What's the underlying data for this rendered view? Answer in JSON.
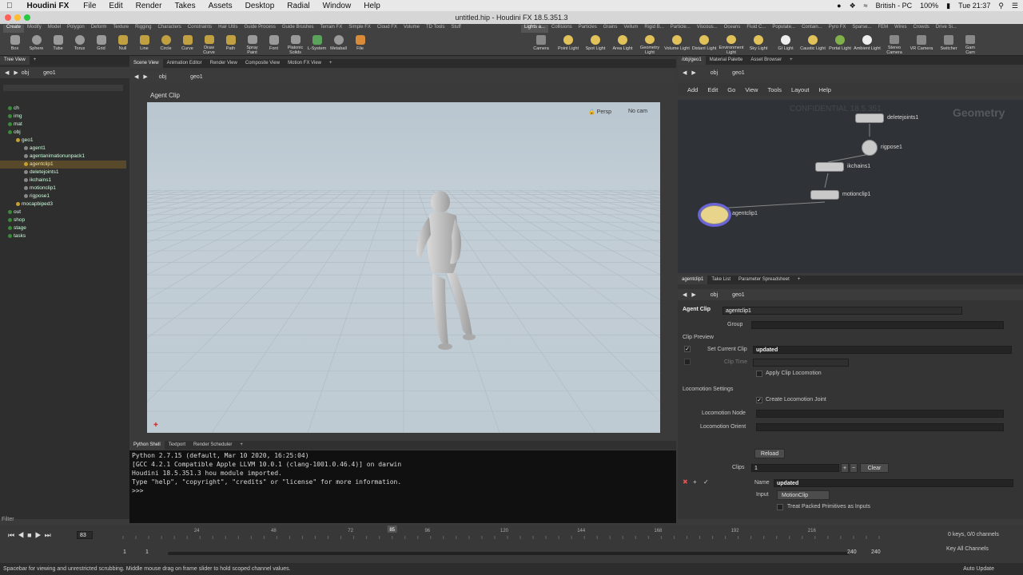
{
  "menubar": {
    "app": "Houdini FX",
    "items": [
      "File",
      "Edit",
      "Render",
      "Takes",
      "Assets",
      "Desktop",
      "Radial",
      "Window",
      "Help"
    ],
    "input_source": "British - PC",
    "battery": "100%",
    "clock": "Tue 21:37"
  },
  "window_title": "untitled.hip - Houdini FX 18.5.351.3",
  "shelf": {
    "tabs_left": [
      "Create",
      "Modify",
      "Model",
      "Polygon",
      "Deform",
      "Texture",
      "Rigging",
      "Characters",
      "Constraints",
      "Hair Utils",
      "Guide Process",
      "Guide Brushes",
      "Terrain FX",
      "Simple FX",
      "Cloud FX",
      "Volume",
      "TD Tools",
      "Stuff"
    ],
    "tools_left": [
      "Box",
      "Sphere",
      "Tube",
      "Torus",
      "Grid",
      "Null",
      "Line",
      "Circle",
      "Curve",
      "Draw Curve",
      "Path",
      "Spray Paint",
      "Font",
      "Platonic Solids",
      "L-System",
      "Metaball",
      "File"
    ],
    "tabs_right": [
      "Lights a...",
      "Collisions",
      "Particles",
      "Grains",
      "Vellum",
      "Rigid B...",
      "Particle...",
      "Viscous...",
      "Oceans",
      "Fluid C...",
      "Populate...",
      "Contain...",
      "Pyro FX",
      "Sparse...",
      "FEM",
      "Wires",
      "Crowds",
      "Drive Si..."
    ],
    "tools_right": [
      "Camera",
      "Point Light",
      "Spot Light",
      "Area Light",
      "Geometry Light",
      "Volume Light",
      "Distant Light",
      "Environment Light",
      "Sky Light",
      "GI Light",
      "Caustic Light",
      "Portal Light",
      "Ambient Light",
      "Stereo Camera",
      "VR Camera",
      "Switcher",
      "Gam Cam"
    ]
  },
  "tree": {
    "tab": "Tree View",
    "path": "obj",
    "node": "geo1",
    "rows": [
      {
        "label": "ch",
        "indent": 1,
        "color": "#3a8a3a"
      },
      {
        "label": "img",
        "indent": 1,
        "color": "#3a8a3a"
      },
      {
        "label": "mat",
        "indent": 1,
        "color": "#3a8a3a"
      },
      {
        "label": "obj",
        "indent": 1,
        "color": "#3a8a3a"
      },
      {
        "label": "geo1",
        "indent": 2,
        "color": "#c5a033"
      },
      {
        "label": "agent1",
        "indent": 3,
        "color": "#888"
      },
      {
        "label": "agentanimationunpack1",
        "indent": 3,
        "color": "#888"
      },
      {
        "label": "agentclip1",
        "indent": 3,
        "color": "#c5a033",
        "selected": true
      },
      {
        "label": "deletejoints1",
        "indent": 3,
        "color": "#888"
      },
      {
        "label": "ikchains1",
        "indent": 3,
        "color": "#888"
      },
      {
        "label": "motionclip1",
        "indent": 3,
        "color": "#888"
      },
      {
        "label": "rigpose1",
        "indent": 3,
        "color": "#888"
      },
      {
        "label": "mocapbiped3",
        "indent": 2,
        "color": "#c5a033"
      },
      {
        "label": "out",
        "indent": 1,
        "color": "#3a8a3a"
      },
      {
        "label": "shop",
        "indent": 1,
        "color": "#3a8a3a"
      },
      {
        "label": "stage",
        "indent": 1,
        "color": "#3a8a3a"
      },
      {
        "label": "tasks",
        "indent": 1,
        "color": "#3a8a3a"
      }
    ],
    "filter_label": "Filter"
  },
  "viewer": {
    "tabs": [
      "Scene View",
      "Animation Editor",
      "Render View",
      "Composite View",
      "Motion FX View"
    ],
    "path": "obj",
    "node": "geo1",
    "title": "Agent Clip",
    "persp": "Persp",
    "cam": "No cam"
  },
  "shell": {
    "tabs": [
      "Python Shell",
      "Textport",
      "Render Scheduler"
    ],
    "lines": [
      "Python 2.7.15 (default, Mar 10 2020, 16:25:04)",
      "[GCC 4.2.1 Compatible Apple LLVM 10.0.1 (clang-1001.0.46.4)] on darwin",
      "Houdini 18.5.351.3 hou module imported.",
      "Type \"help\", \"copyright\", \"credits\" or \"license\" for more information.",
      ">>> "
    ]
  },
  "network": {
    "tabs": [
      "/obj/geo1",
      "Material Palette",
      "Asset Browser"
    ],
    "path": "obj",
    "node": "geo1",
    "menu": [
      "Add",
      "Edit",
      "Go",
      "View",
      "Tools",
      "Layout",
      "Help"
    ],
    "watermark": "CONFIDENTIAL 18.5.351",
    "context": "Geometry",
    "nodes": [
      "deletejoints1",
      "rigpose1",
      "ikchains1",
      "motionclip1",
      "agentclip1"
    ]
  },
  "params": {
    "tabs": [
      "agentclip1",
      "Take List",
      "Parameter Spreadsheet"
    ],
    "path": "obj",
    "node": "geo1",
    "type": "Agent Clip",
    "name": "agentclip1",
    "group_label": "Group",
    "clip_preview": "Clip Preview",
    "set_current_clip_label": "Set Current Clip",
    "set_current_clip_value": "updated",
    "clip_time_label": "Clip Time",
    "apply_locomotion": "Apply Clip Locomotion",
    "locomotion_settings": "Locomotion Settings",
    "create_joint": "Create Locomotion Joint",
    "locomotion_node": "Locomotion Node",
    "locomotion_orient": "Locomotion Orient",
    "reload": "Reload",
    "clips_label": "Clips",
    "clips_value": "1",
    "clear": "Clear",
    "name_label": "Name",
    "name_value": "updated",
    "input_label": "Input",
    "input_value": "MotionClip",
    "treat_packed": "Treat Packed Primitives as Inputs"
  },
  "timeline": {
    "frame": "83",
    "current_marker": "85",
    "ticks": [
      "24",
      "48",
      "72",
      "96",
      "120",
      "144",
      "168",
      "192",
      "216"
    ],
    "start": "1",
    "start2": "1",
    "end": "240",
    "end2": "240",
    "keys": "0 keys, 0/0 channels",
    "key_all": "Key All Channels",
    "auto_update": "Auto Update",
    "status": "Spacebar for viewing and unrestricted scrubbing. Middle mouse drag on frame slider to hold scoped channel values."
  }
}
